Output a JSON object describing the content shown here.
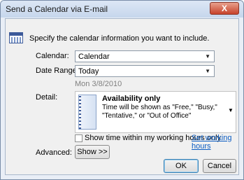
{
  "window": {
    "title": "Send a Calendar via E-mail",
    "close_glyph": "X"
  },
  "intro": {
    "icon": "calendar-icon",
    "text": "Specify the calendar information you want to include."
  },
  "fields": {
    "calendar_label": "Calendar:",
    "calendar_value": "Calendar",
    "date_range_label": "Date Range:",
    "date_range_value": "Today",
    "date_text": "Mon 3/8/2010",
    "dropdown_arrow": "▼"
  },
  "detail": {
    "label": "Detail:",
    "title": "Availability only",
    "description": "Time will be shown as \"Free,\" \"Busy,\" \"Tentative,\" or \"Out of Office\""
  },
  "options": {
    "working_hours_label": "Show time within my working hours only",
    "working_hours_checked": false,
    "set_working_hours_link": "Set working hours"
  },
  "advanced": {
    "label": "Advanced:",
    "show_button": "Show >>"
  },
  "actions": {
    "ok": "OK",
    "cancel": "Cancel"
  }
}
